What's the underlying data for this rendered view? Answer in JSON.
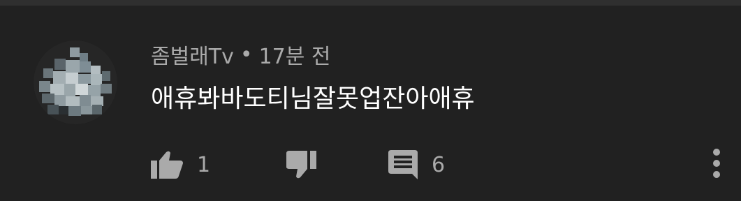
{
  "comment": {
    "author": "좀벌래Tv",
    "separator": "•",
    "time": "17분 전",
    "text": "애휴봐바도티님잘못업잔아애휴"
  },
  "actions": {
    "like_icon": "thumbs-up-icon",
    "like_count": "1",
    "dislike_icon": "thumbs-down-icon",
    "reply_icon": "comment-icon",
    "reply_count": "6",
    "more_icon": "more-vertical-icon"
  },
  "colors": {
    "background": "#212121",
    "divider": "#2f2f2f",
    "text_primary": "#ffffff",
    "text_secondary": "#aaaaaa"
  }
}
